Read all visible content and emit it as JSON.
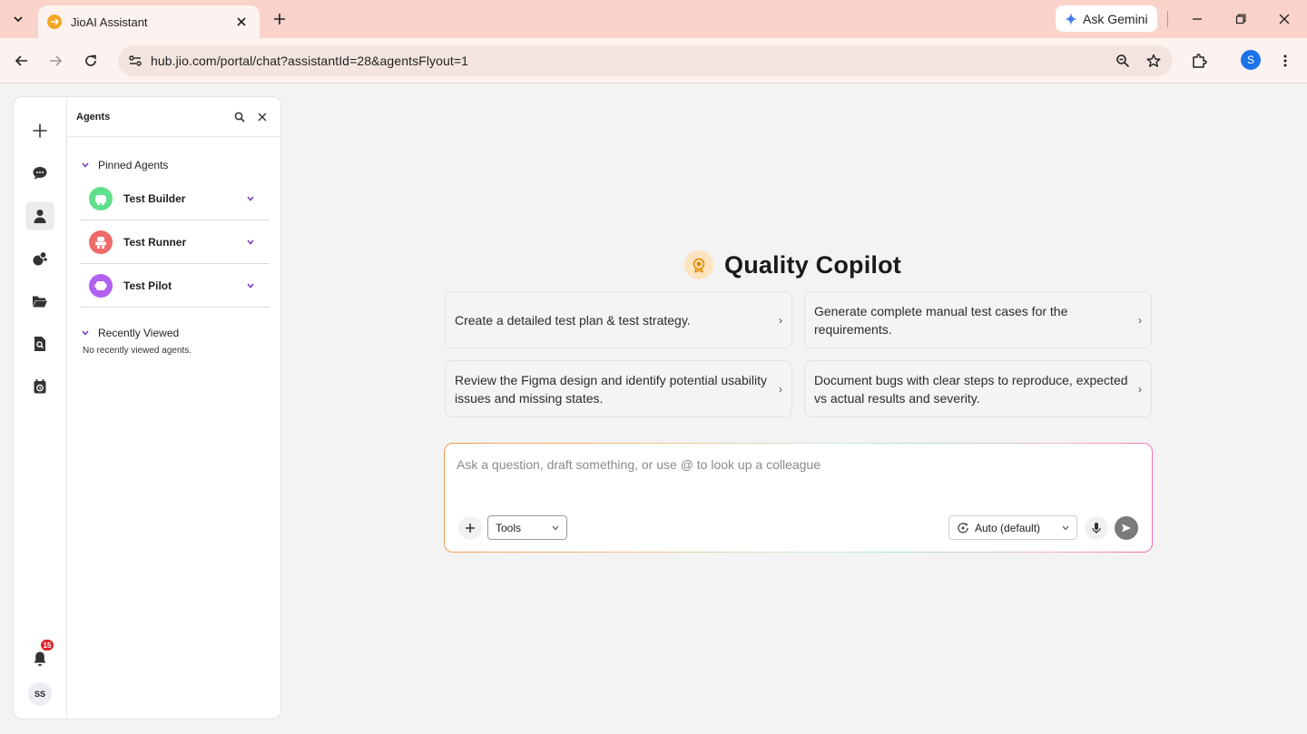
{
  "browser": {
    "tab_title": "JioAI Assistant",
    "url": "hub.jio.com/portal/chat?assistantId=28&agentsFlyout=1",
    "gemini_label": "Ask Gemini",
    "profile_initial": "S"
  },
  "sidebar": {
    "rail_icons": [
      "plus-icon",
      "chat-icon",
      "person-icon",
      "agents-icon",
      "folder-icon",
      "search-document-icon",
      "calendar-icon"
    ],
    "notification_count": "15",
    "avatar_initials": "SS"
  },
  "flyout": {
    "title": "Agents",
    "pinned_label": "Pinned Agents",
    "agents": [
      {
        "name": "Test Builder",
        "color": "#5fe08a"
      },
      {
        "name": "Test Runner",
        "color": "#f06a6a"
      },
      {
        "name": "Test Pilot",
        "color": "#b061f0"
      }
    ],
    "recent_label": "Recently Viewed",
    "recent_empty": "No recently viewed agents."
  },
  "main": {
    "title": "Quality Copilot",
    "suggestions": [
      "Create a detailed test plan & test strategy.",
      "Generate complete manual test cases for the requirements.",
      "Review the Figma design and identify potential usability issues and missing states.",
      "Document bugs with clear steps to reproduce, expected vs actual results and severity."
    ],
    "composer": {
      "placeholder": "Ask a question, draft something, or use @ to look up a colleague",
      "value": "",
      "tools_label": "Tools",
      "model_label": "Auto (default)"
    }
  },
  "colors": {
    "tabstrip": "#f9d3c9",
    "toolbar": "#fdf2ef",
    "accent_purple": "#7b2fbe",
    "heading_icon_bg": "#fde3bf"
  }
}
